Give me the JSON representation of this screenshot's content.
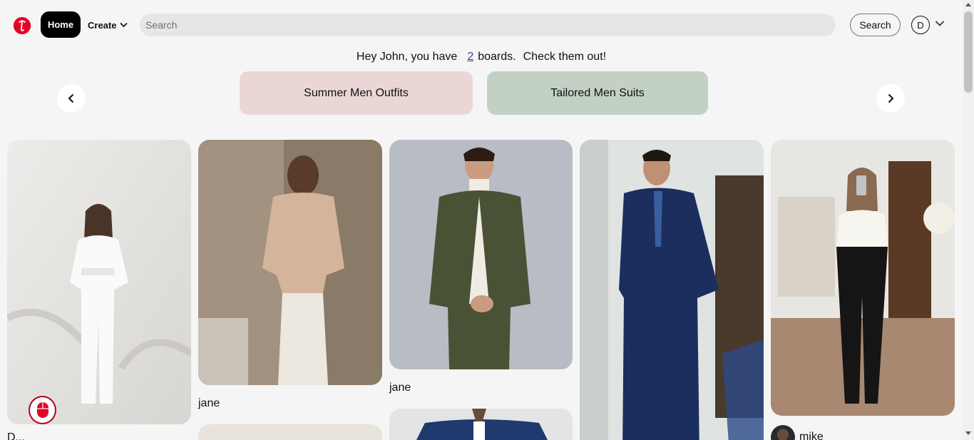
{
  "header": {
    "home_label": "Home",
    "create_label": "Create",
    "search_placeholder": "Search",
    "search_button": "Search",
    "avatar_initial": "D"
  },
  "greeting": {
    "prefix": "Hey John, you have",
    "board_count": "2",
    "suffix": "boards.",
    "cta": "Check them out!"
  },
  "boards": [
    {
      "label": "Summer Men Outfits",
      "color": "#ebd6d6"
    },
    {
      "label": "Tailored Men Suits",
      "color": "#c2d1c4"
    }
  ],
  "pins": [
    {
      "author": "D..."
    },
    {
      "author": "jane"
    },
    {
      "author": "jane"
    },
    {
      "author": ""
    },
    {
      "author": "mike"
    }
  ],
  "colors": {
    "brand": "#e60023",
    "background": "#f5f5f5",
    "search_bg": "#e6e6e6"
  }
}
